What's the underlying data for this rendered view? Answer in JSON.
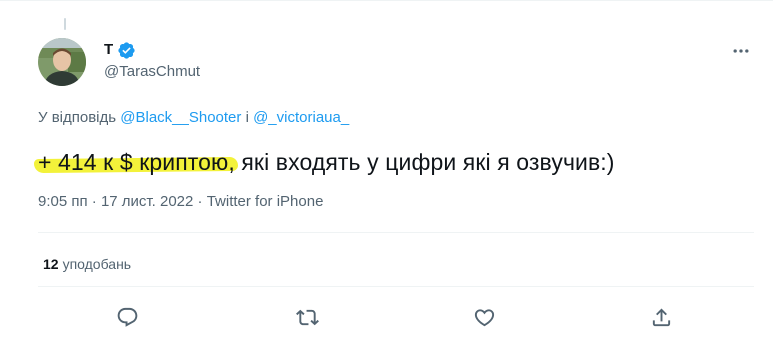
{
  "tweet": {
    "display_name": "Т",
    "handle": "@TarasChmut",
    "reply": {
      "prefix": "У відповідь ",
      "mention_1": "@Black__Shooter",
      "joiner": " і ",
      "mention_2": "@_victoriaua_"
    },
    "text": {
      "highlighted": "+ 414 к $ криптою,",
      "rest": " які входять у цифри які я озвучив:)"
    },
    "meta": {
      "time": "9:05 пп",
      "separator_1": " · ",
      "date": "17 лист. 2022",
      "separator_2": " · ",
      "source": "Twitter for iPhone"
    },
    "likes": {
      "count": "12",
      "label": "уподобань"
    }
  },
  "icons": {
    "verified": "verified-badge-icon",
    "more": "more-options-icon",
    "reply": "reply-icon",
    "retweet": "retweet-icon",
    "like": "heart-icon",
    "share": "share-icon"
  },
  "colors": {
    "accent": "#1d9bf0",
    "highlight": "#f3f23a",
    "secondary_text": "#536471",
    "primary_text": "#0f1419"
  }
}
